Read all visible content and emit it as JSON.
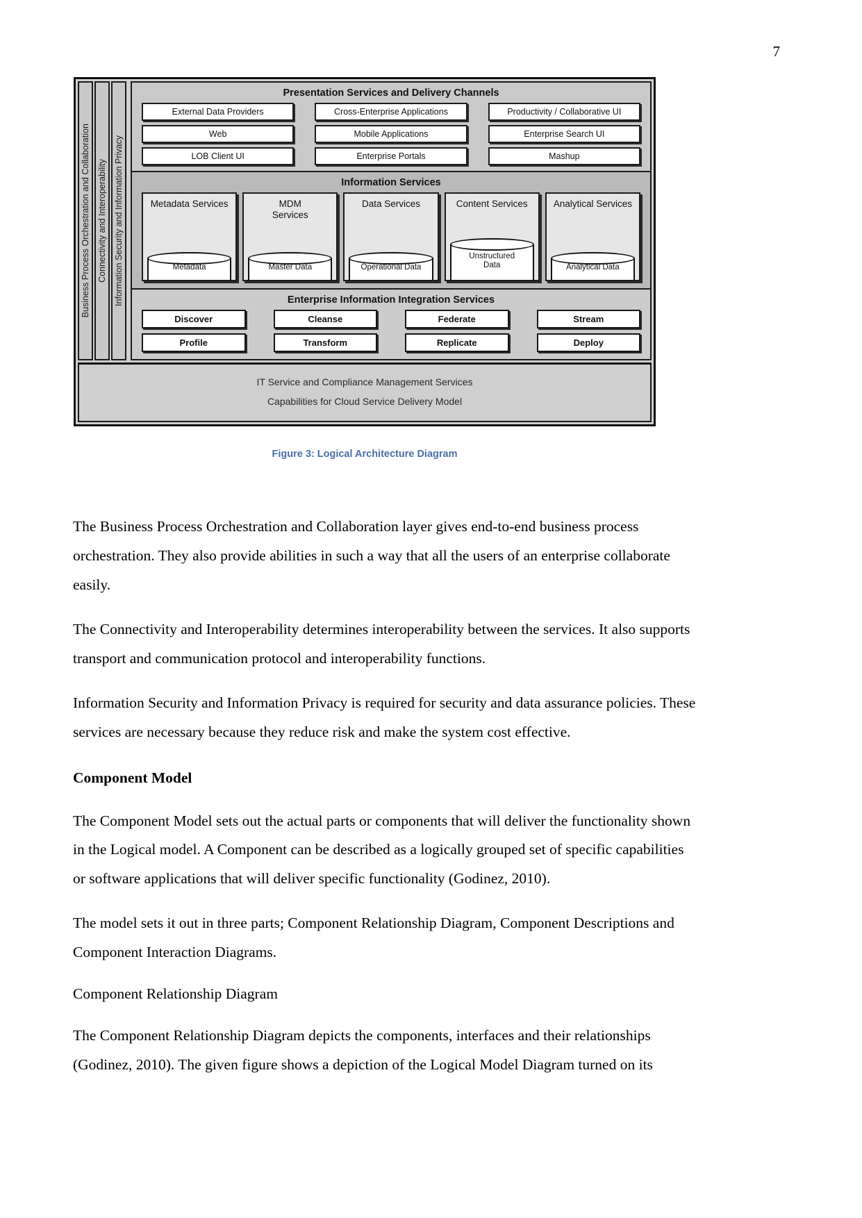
{
  "page": {
    "number": "7"
  },
  "figure": {
    "caption": "Figure 3: Logical Architecture Diagram",
    "side_bars": [
      "Business Process Orchestration and Collaboration",
      "Connectivity and Interoperability",
      "Information Security and Information Privacy"
    ],
    "presentation": {
      "title": "Presentation Services and Delivery Channels",
      "items": [
        "External Data Providers",
        "Cross-Enterprise Applications",
        "Productivity / Collaborative UI",
        "Web",
        "Mobile Applications",
        "Enterprise Search UI",
        "LOB Client UI",
        "Enterprise Portals",
        "Mashup"
      ]
    },
    "information_services": {
      "title": "Information Services",
      "cards": [
        {
          "name": "Metadata Services",
          "store": "Metadata",
          "tall": false
        },
        {
          "name": "MDM\nServices",
          "store": "Master Data",
          "tall": false
        },
        {
          "name": "Data Services",
          "store": "Operational Data",
          "tall": false
        },
        {
          "name": "Content Services",
          "store": "Unstructured\nData",
          "tall": true
        },
        {
          "name": "Analytical Services",
          "store": "Analytical Data",
          "tall": false
        }
      ]
    },
    "integration": {
      "title": "Enterprise Information Integration Services",
      "items": [
        "Discover",
        "Cleanse",
        "Federate",
        "Stream",
        "Profile",
        "Transform",
        "Replicate",
        "Deploy"
      ]
    },
    "footer": {
      "lines": [
        "IT Service and Compliance Management Services",
        "Capabilities for Cloud Service Delivery Model"
      ]
    }
  },
  "body": {
    "p1": "The Business Process Orchestration and Collaboration layer gives end-to-end business process orchestration. They also provide abilities in such a way that all the users of an enterprise collaborate easily.",
    "p2": "The Connectivity and Interoperability determines interoperability between the services. It also supports transport and communication protocol and interoperability functions.",
    "p3": "Information Security and Information Privacy is required for security and data assurance policies. These services are necessary because they reduce risk and make the system cost effective.",
    "heading1": "Component Model",
    "p4": "The Component Model sets out the actual parts or components that will deliver the functionality shown in the Logical model. A Component can be described as a logically grouped set of specific capabilities or software applications that will deliver specific functionality (Godinez, 2010).",
    "p5": "The model sets it out in three parts; Component Relationship Diagram, Component Descriptions and Component Interaction Diagrams.",
    "p6": "Component Relationship Diagram",
    "p7": "The Component Relationship Diagram depicts the components, interfaces and their relationships (Godinez, 2010). The given figure shows a depiction of the Logical Model Diagram turned on its"
  },
  "colors": {
    "caption_blue": "#4a6fa5",
    "band_presentation": "#c9c9c9",
    "band_information": "#b9b9b9",
    "band_integration": "#cccccc",
    "band_footer": "#cfcfcf"
  }
}
